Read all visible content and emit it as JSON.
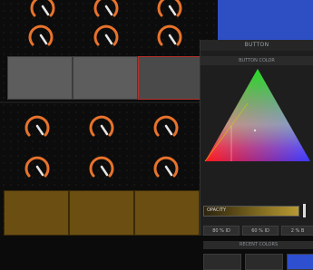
{
  "panel": {
    "title": "BUTTON",
    "color_section_title": "BUTTON COLOR",
    "opacity_label": "OPACITY",
    "percent_buttons": [
      "80 % ID",
      "60 % ID",
      "2 % B"
    ],
    "recent_title": "RECENT COLORS",
    "recent_swatches": [
      "#2b2b2b",
      "#2b2b2b",
      "#2d4fd0"
    ]
  },
  "colors": {
    "knob_accent": "#e8732c",
    "pad_gold": "#6b4e12",
    "selection_red": "#b5302a",
    "blue_block": "#2e4fc4"
  },
  "icons": [
    "knob-icon",
    "color-triangle"
  ],
  "opacity_level": 1.0
}
